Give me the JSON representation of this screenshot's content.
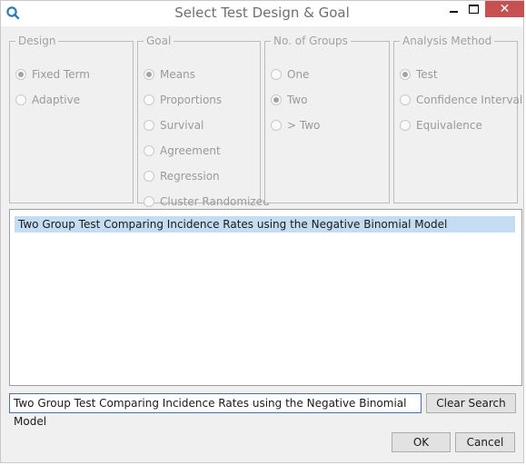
{
  "window": {
    "title": "Select Test Design & Goal",
    "close_glyph": "✕"
  },
  "groups": [
    {
      "legend": "Design",
      "options": [
        {
          "label": "Fixed Term",
          "checked": true
        },
        {
          "label": "Adaptive",
          "checked": false
        }
      ]
    },
    {
      "legend": "Goal",
      "options": [
        {
          "label": "Means",
          "checked": true
        },
        {
          "label": "Proportions",
          "checked": false
        },
        {
          "label": "Survival",
          "checked": false
        },
        {
          "label": "Agreement",
          "checked": false
        },
        {
          "label": "Regression",
          "checked": false
        },
        {
          "label": "Cluster Randomized",
          "checked": false
        }
      ]
    },
    {
      "legend": "No. of Groups",
      "options": [
        {
          "label": "One",
          "checked": false
        },
        {
          "label": "Two",
          "checked": true
        },
        {
          "label": "> Two",
          "checked": false
        }
      ]
    },
    {
      "legend": "Analysis Method",
      "options": [
        {
          "label": "Test",
          "checked": true
        },
        {
          "label": "Confidence Interval",
          "checked": false
        },
        {
          "label": "Equivalence",
          "checked": false
        }
      ]
    }
  ],
  "results": {
    "items": [
      "Two Group Test Comparing Incidence Rates using the Negative Binomial Model"
    ]
  },
  "search": {
    "value": "Two Group Test Comparing Incidence Rates using the Negative Binomial Model",
    "clear_label": "Clear Search"
  },
  "footer": {
    "ok_label": "OK",
    "cancel_label": "Cancel"
  },
  "colors": {
    "selection": "#c4ddf2",
    "close_button": "#c75050",
    "input_border": "#4f6ea8"
  }
}
